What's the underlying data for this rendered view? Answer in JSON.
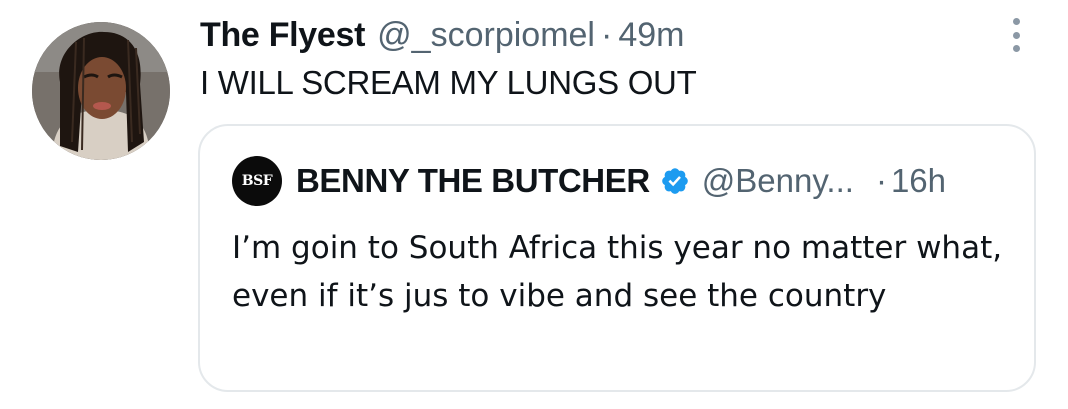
{
  "tweet": {
    "display_name": "The Flyest",
    "handle": "@_scorpiomel",
    "separator": "·",
    "time": "49m",
    "text": "I WILL SCREAM MY LUNGS OUT",
    "avatar_icon": "profile-photo",
    "more_icon": "vertical-ellipsis-icon"
  },
  "quote": {
    "avatar_text": "BSF",
    "display_name": "BENNY THE BUTCHER",
    "verified_icon": "verified-badge-icon",
    "handle": "@Benny...",
    "separator": "·",
    "time": "16h",
    "text": "I’m goin to South Africa this year no matter what, even if it’s jus to vibe and see the country"
  },
  "colors": {
    "text_primary": "#0f1419",
    "text_secondary": "#536471",
    "verified_blue": "#1d9bf0",
    "border": "#e4e8eb"
  }
}
